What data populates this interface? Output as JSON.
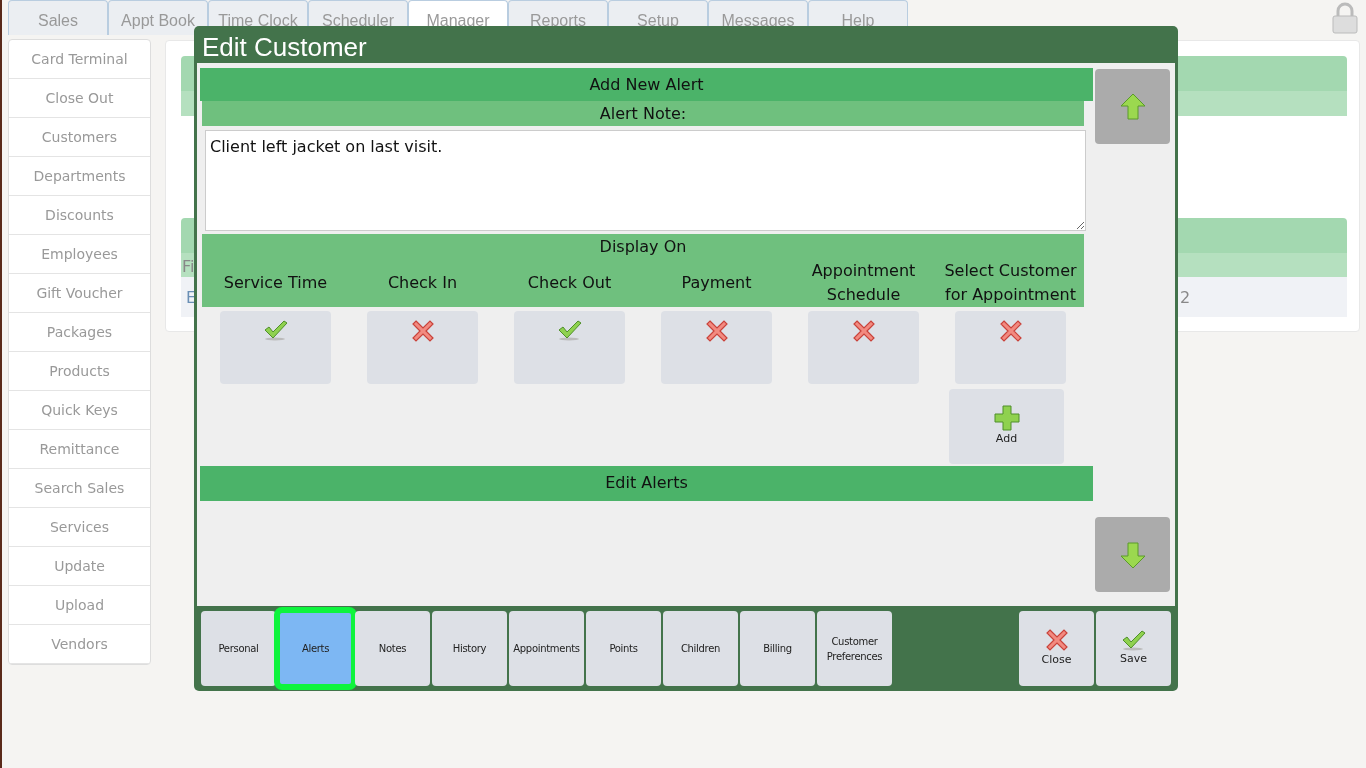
{
  "top_tabs": [
    {
      "label": "Sales",
      "selected": false
    },
    {
      "label": "Appt Book",
      "selected": false
    },
    {
      "label": "Time Clock",
      "selected": false
    },
    {
      "label": "Scheduler",
      "selected": false
    },
    {
      "label": "Manager",
      "selected": true
    },
    {
      "label": "Reports",
      "selected": false
    },
    {
      "label": "Setup",
      "selected": false
    },
    {
      "label": "Messages",
      "selected": false
    },
    {
      "label": "Help",
      "selected": false
    }
  ],
  "sidebar": {
    "items": [
      "Card Terminal",
      "Close Out",
      "Customers",
      "Departments",
      "Discounts",
      "Employees",
      "Gift Voucher",
      "Packages",
      "Products",
      "Quick Keys",
      "Remittance",
      "Search Sales",
      "Services",
      "Update",
      "Upload",
      "Vendors"
    ]
  },
  "background_fragments": {
    "column_header": "Fi",
    "row_start": "E",
    "row_end": "2"
  },
  "dialog": {
    "title": "Edit Customer",
    "add_alert": {
      "heading": "Add New Alert",
      "note_label": "Alert Note:",
      "note": "Client left jacket on last visit.",
      "display_on_label": "Display On",
      "display_on": [
        {
          "label": "Service Time",
          "on": true
        },
        {
          "label": "Check In",
          "on": false
        },
        {
          "label": "Check Out",
          "on": true
        },
        {
          "label": "Payment",
          "on": false
        },
        {
          "label": "Appointment Schedule",
          "on": false
        },
        {
          "label": "Select Customer for Appointment",
          "on": false
        }
      ],
      "add_button": "Add"
    },
    "edit_alerts": {
      "heading": "Edit Alerts"
    },
    "tabs": [
      {
        "label": "Personal",
        "selected": false
      },
      {
        "label": "Alerts",
        "selected": true
      },
      {
        "label": "Notes",
        "selected": false
      },
      {
        "label": "History",
        "selected": false
      },
      {
        "label": "Appointments",
        "selected": false
      },
      {
        "label": "Points",
        "selected": false
      },
      {
        "label": "Children",
        "selected": false
      },
      {
        "label": "Billing",
        "selected": false
      },
      {
        "label": "Customer Preferences",
        "selected": false
      }
    ],
    "close_button": "Close",
    "save_button": "Save"
  }
}
